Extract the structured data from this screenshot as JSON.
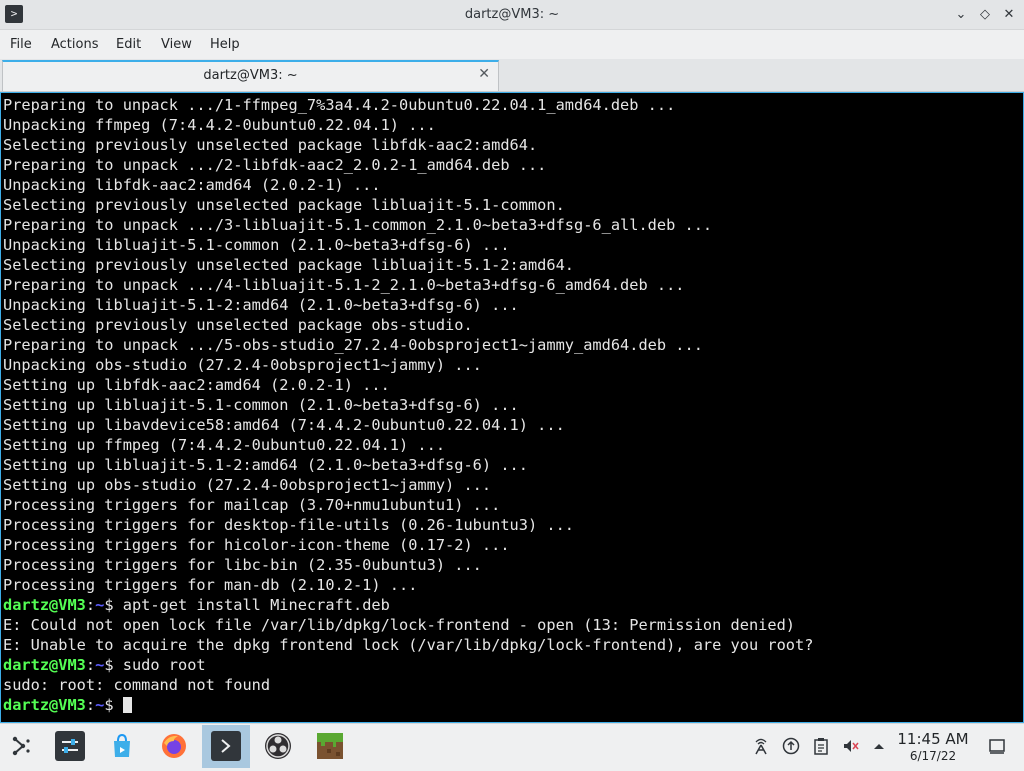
{
  "window": {
    "title": "dartz@VM3: ~",
    "app_icon": ">",
    "controls": {
      "minimize": "⌄",
      "maximize": "◇",
      "close": "✕"
    }
  },
  "menu": {
    "file": "File",
    "actions": "Actions",
    "edit": "Edit",
    "view": "View",
    "help": "Help"
  },
  "tab": {
    "label": "dartz@VM3: ~",
    "close": "✕"
  },
  "prompt": {
    "user": "dartz@VM3",
    "colon": ":",
    "path": "~",
    "symbol": "$ "
  },
  "terminal": {
    "output": [
      "Preparing to unpack .../1-ffmpeg_7%3a4.4.2-0ubuntu0.22.04.1_amd64.deb ...",
      "Unpacking ffmpeg (7:4.4.2-0ubuntu0.22.04.1) ...",
      "Selecting previously unselected package libfdk-aac2:amd64.",
      "Preparing to unpack .../2-libfdk-aac2_2.0.2-1_amd64.deb ...",
      "Unpacking libfdk-aac2:amd64 (2.0.2-1) ...",
      "Selecting previously unselected package libluajit-5.1-common.",
      "Preparing to unpack .../3-libluajit-5.1-common_2.1.0~beta3+dfsg-6_all.deb ...",
      "Unpacking libluajit-5.1-common (2.1.0~beta3+dfsg-6) ...",
      "Selecting previously unselected package libluajit-5.1-2:amd64.",
      "Preparing to unpack .../4-libluajit-5.1-2_2.1.0~beta3+dfsg-6_amd64.deb ...",
      "Unpacking libluajit-5.1-2:amd64 (2.1.0~beta3+dfsg-6) ...",
      "Selecting previously unselected package obs-studio.",
      "Preparing to unpack .../5-obs-studio_27.2.4-0obsproject1~jammy_amd64.deb ...",
      "Unpacking obs-studio (27.2.4-0obsproject1~jammy) ...",
      "Setting up libfdk-aac2:amd64 (2.0.2-1) ...",
      "Setting up libluajit-5.1-common (2.1.0~beta3+dfsg-6) ...",
      "Setting up libavdevice58:amd64 (7:4.4.2-0ubuntu0.22.04.1) ...",
      "Setting up ffmpeg (7:4.4.2-0ubuntu0.22.04.1) ...",
      "Setting up libluajit-5.1-2:amd64 (2.1.0~beta3+dfsg-6) ...",
      "Setting up obs-studio (27.2.4-0obsproject1~jammy) ...",
      "Processing triggers for mailcap (3.70+nmu1ubuntu1) ...",
      "Processing triggers for desktop-file-utils (0.26-1ubuntu3) ...",
      "Processing triggers for hicolor-icon-theme (0.17-2) ...",
      "Processing triggers for libc-bin (2.35-0ubuntu3) ...",
      "Processing triggers for man-db (2.10.2-1) ..."
    ],
    "cmd1": "apt-get install Minecraft.deb",
    "err1": "E: Could not open lock file /var/lib/dpkg/lock-frontend - open (13: Permission denied)",
    "err2": "E: Unable to acquire the dpkg frontend lock (/var/lib/dpkg/lock-frontend), are you root?",
    "cmd2": "sudo root",
    "err3": "sudo: root: command not found"
  },
  "taskbar": {
    "icons": {
      "launcher": "launcher-icon",
      "settings": "settings-icon",
      "store": "discover-store-icon",
      "firefox": "firefox-icon",
      "terminal": "terminal-icon",
      "obs": "obs-studio-icon",
      "minecraft": "minecraft-icon"
    },
    "tray": {
      "network": "network-icon",
      "updates": "updates-icon",
      "clipboard": "clipboard-icon",
      "volume": "volume-muted-icon",
      "expand": "expand-tray-icon",
      "show_desktop": "show-desktop-icon"
    },
    "clock": {
      "time": "11:45 AM",
      "date": "6/17/22"
    }
  },
  "colors": {
    "accent": "#3daee9",
    "terminal_bg": "#000000",
    "prompt_user": "#54ff54",
    "prompt_path": "#5c5cff"
  }
}
